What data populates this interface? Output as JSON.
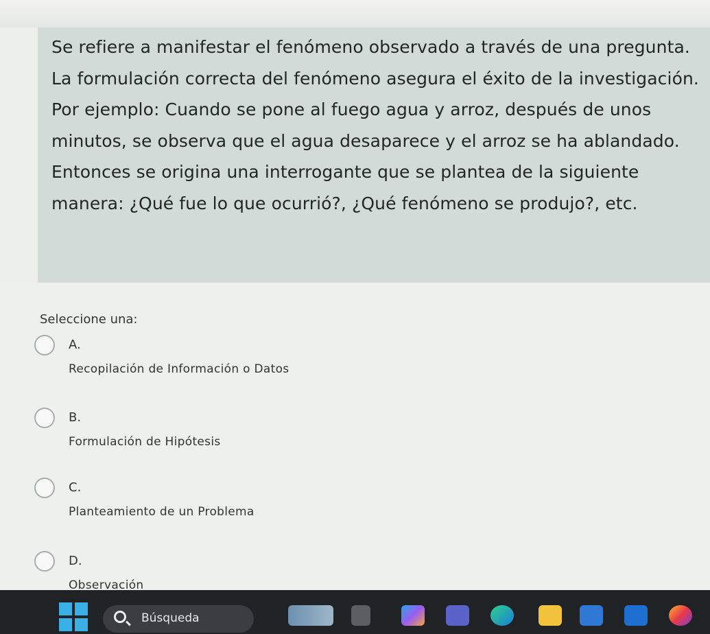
{
  "question": {
    "text": "Se refiere a manifestar el fenómeno observado a través de una pregunta. La formulación correcta del fenómeno asegura el éxito de la investigación. Por ejemplo: Cuando se pone al fuego agua y arroz, después de unos minutos, se observa que el agua desaparece y el arroz se ha ablandado. Entonces se origina una interrogante que se plantea de la siguiente manera: ¿Qué fue lo que ocurrió?, ¿Qué fenómeno se produjo?, etc."
  },
  "prompt": "Seleccione una:",
  "options": [
    {
      "letter": "A.",
      "text": "Recopilación de Información o Datos"
    },
    {
      "letter": "B.",
      "text": "Formulación de Hipótesis"
    },
    {
      "letter": "C.",
      "text": "Planteamiento de un Problema"
    },
    {
      "letter": "D.",
      "text": "Observación"
    }
  ],
  "taskbar": {
    "search_label": "Búsqueda",
    "icons": [
      "start-icon",
      "search-icon",
      "weather-widget-icon",
      "task-view-icon",
      "copilot-icon",
      "teams-icon",
      "edge-icon",
      "file-explorer-icon",
      "store-icon",
      "outlook-icon",
      "firefox-icon"
    ]
  },
  "colors": {
    "question_bg": "#d3dbd8",
    "page_bg": "#eef0ee",
    "taskbar_bg": "#202326"
  }
}
